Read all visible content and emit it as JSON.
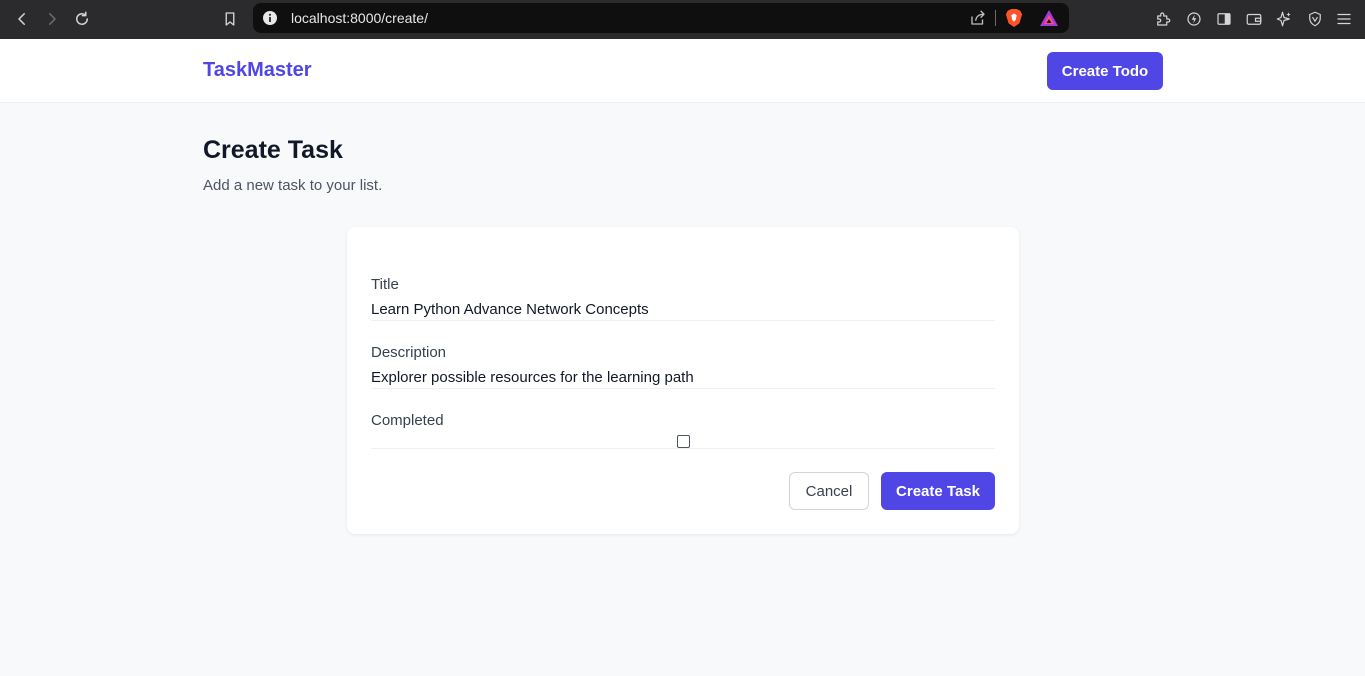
{
  "browser": {
    "url": "localhost:8000/create/"
  },
  "header": {
    "brand": "TaskMaster",
    "create_todo_label": "Create Todo"
  },
  "page": {
    "title": "Create Task",
    "subtitle": "Add a new task to your list."
  },
  "form": {
    "title_label": "Title",
    "title_value": "Learn Python Advance Network Concepts",
    "description_label": "Description",
    "description_value": "Explorer possible resources for the learning path",
    "completed_label": "Completed",
    "completed_checked": false,
    "cancel_label": "Cancel",
    "submit_label": "Create Task"
  },
  "colors": {
    "accent": "#4f46e5",
    "background": "#f8f9fb",
    "chrome": "#2b2b2e"
  },
  "icons": {
    "back": "back-arrow-icon",
    "forward": "forward-arrow-icon",
    "reload": "reload-icon",
    "bookmark": "bookmark-icon",
    "info": "site-info-icon",
    "share": "share-icon",
    "brave": "brave-shields-icon",
    "rewards": "brave-rewards-icon",
    "extensions": "extensions-icon",
    "leo": "leo-ai-icon",
    "sidebar": "sidebar-icon",
    "wallet": "wallet-icon",
    "sparkle": "sparkle-icon",
    "vpn": "vpn-shield-icon",
    "menu": "menu-icon"
  }
}
